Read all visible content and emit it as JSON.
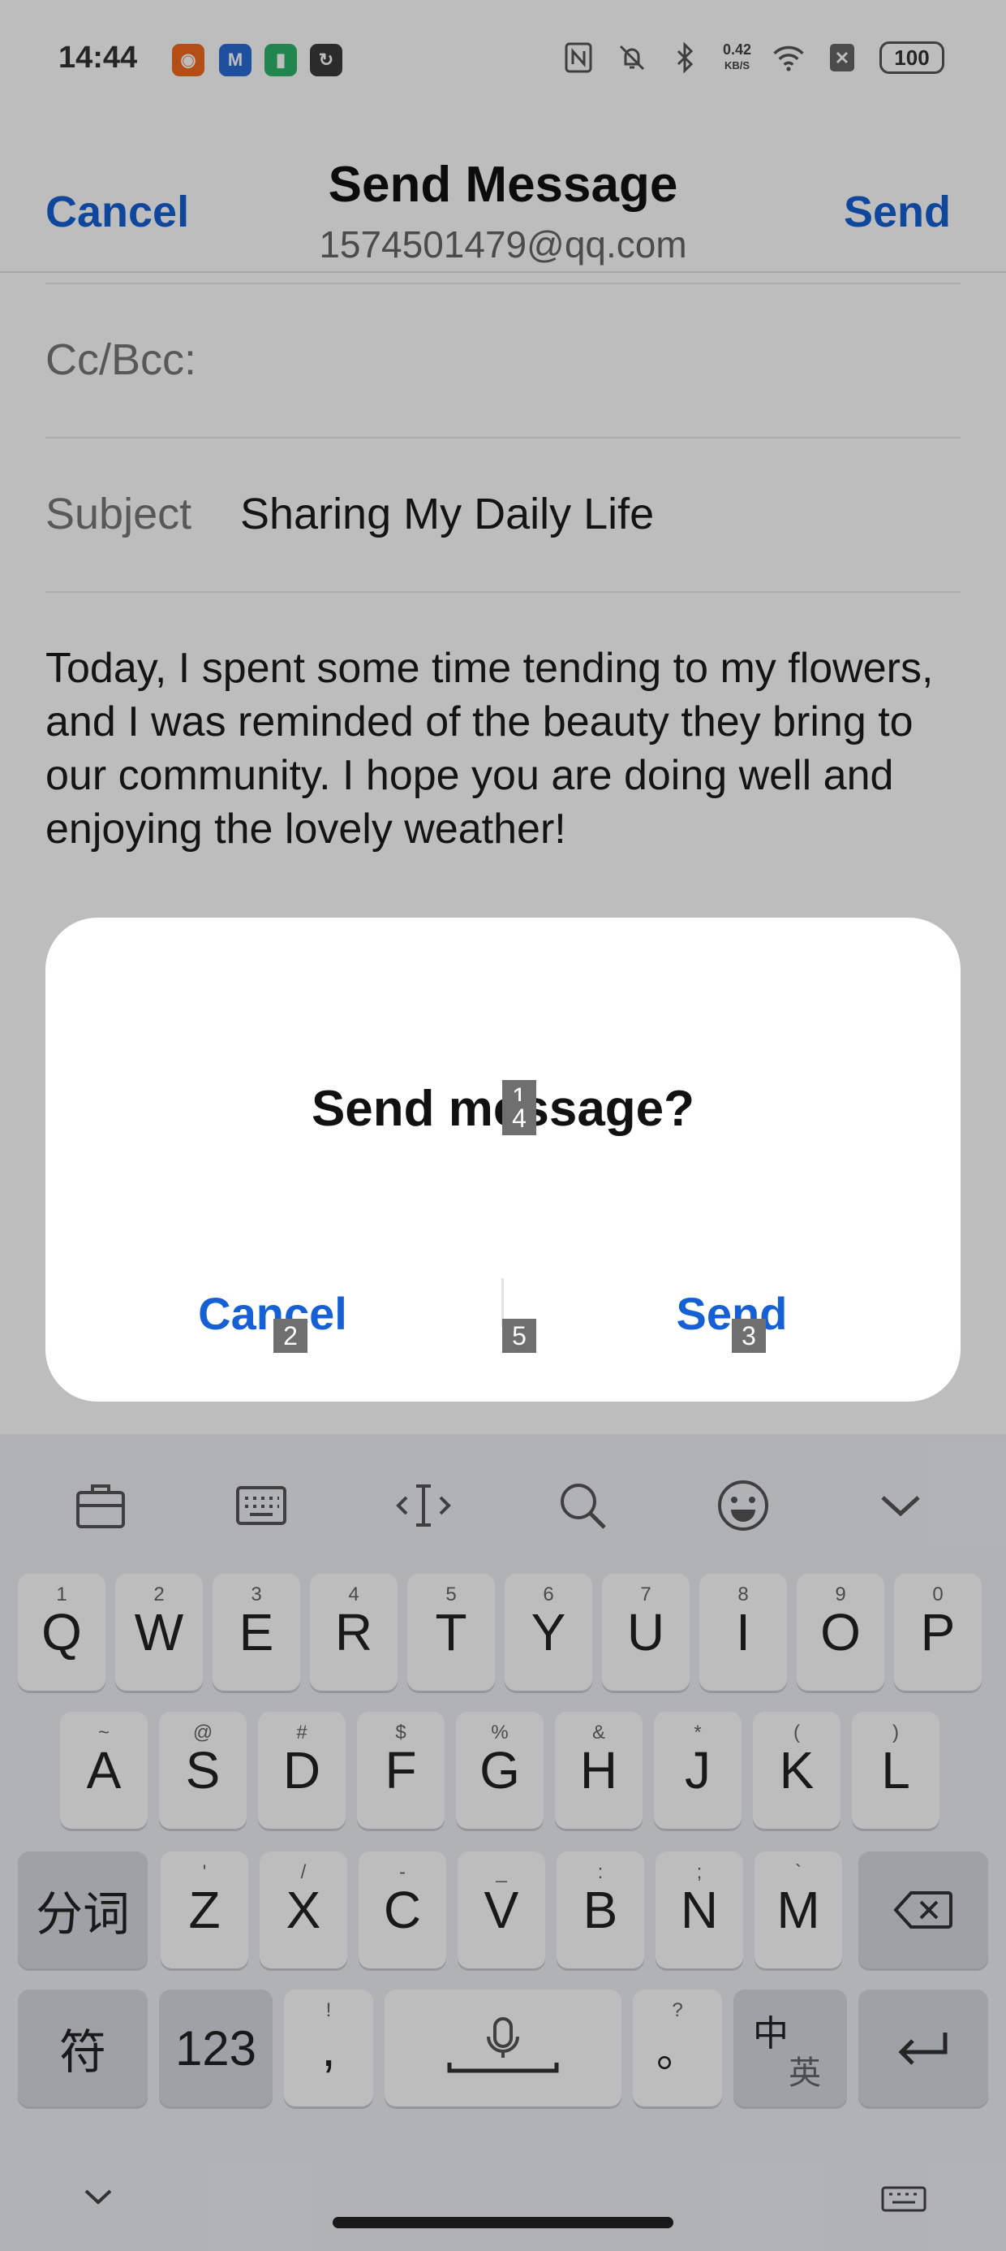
{
  "status_bar": {
    "time": "14:44",
    "apps": [
      {
        "icon": "app-orange-icon",
        "glyph": "◉",
        "color": "#f06a1e"
      },
      {
        "icon": "gmail-icon",
        "glyph": "M",
        "color": "#2b6cd4"
      },
      {
        "icon": "battery-app-icon",
        "glyph": "▮",
        "color": "#2fb46a"
      },
      {
        "icon": "app-link-icon",
        "glyph": "↻",
        "color": "#3a3a3a"
      }
    ],
    "network_speed": "0.42",
    "network_unit": "KB/S",
    "battery": "100"
  },
  "header": {
    "cancel_label": "Cancel",
    "title": "Send Message",
    "subtitle": "1574501479@qq.com",
    "send_label": "Send"
  },
  "form": {
    "cc_label": "Cc/Bcc:",
    "cc_value": "",
    "subject_label": "Subject",
    "subject_value": "Sharing My Daily Life",
    "body": "Today, I spent some time tending to my flowers, and I was reminded of the beauty they bring to our community. I hope you are doing well and enjoying the lovely weather!"
  },
  "dialog": {
    "title": "Send message?",
    "cancel_label": "Cancel",
    "send_label": "Send"
  },
  "markers": {
    "m1": "1",
    "m2": "2",
    "m3": "3",
    "m4": "4",
    "m5": "5"
  },
  "keyboard": {
    "toolbar_icons": [
      "clipboard-icon",
      "keyboard-layout-icon",
      "cursor-icon",
      "search-icon",
      "emoji-icon",
      "collapse-icon"
    ],
    "row1": [
      {
        "main": "Q",
        "hint": "1"
      },
      {
        "main": "W",
        "hint": "2"
      },
      {
        "main": "E",
        "hint": "3"
      },
      {
        "main": "R",
        "hint": "4"
      },
      {
        "main": "T",
        "hint": "5"
      },
      {
        "main": "Y",
        "hint": "6"
      },
      {
        "main": "U",
        "hint": "7"
      },
      {
        "main": "I",
        "hint": "8"
      },
      {
        "main": "O",
        "hint": "9"
      },
      {
        "main": "P",
        "hint": "0"
      }
    ],
    "row2": [
      {
        "main": "A",
        "hint": "~"
      },
      {
        "main": "S",
        "hint": "@"
      },
      {
        "main": "D",
        "hint": "#"
      },
      {
        "main": "F",
        "hint": "$"
      },
      {
        "main": "G",
        "hint": "%"
      },
      {
        "main": "H",
        "hint": "&"
      },
      {
        "main": "J",
        "hint": "*"
      },
      {
        "main": "K",
        "hint": "("
      },
      {
        "main": "L",
        "hint": ")"
      }
    ],
    "row3": [
      {
        "main": "Z",
        "hint": "'"
      },
      {
        "main": "X",
        "hint": "/"
      },
      {
        "main": "C",
        "hint": "-"
      },
      {
        "main": "V",
        "hint": "_"
      },
      {
        "main": "B",
        "hint": ":"
      },
      {
        "main": "N",
        "hint": ";"
      },
      {
        "main": "M",
        "hint": "`"
      }
    ],
    "segment_key": "分词",
    "symbol_key": "符",
    "numbers_key": "123",
    "comma_key": ",",
    "comma_hint": "!",
    "period_key": "。",
    "period_hint": "?",
    "lang_key_top": "中",
    "lang_key_bottom": "英"
  }
}
